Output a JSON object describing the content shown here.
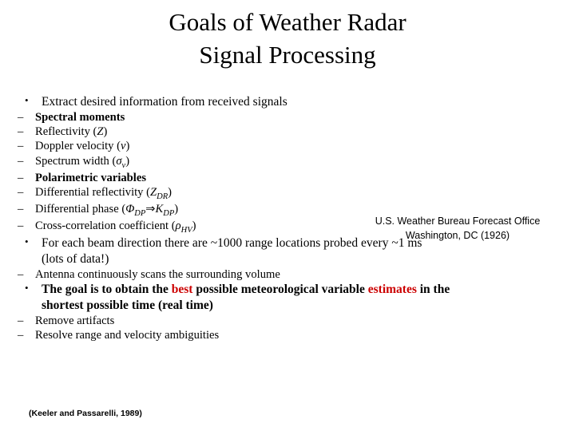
{
  "title": {
    "line1": "Goals of Weather Radar",
    "line2": "Signal Processing"
  },
  "bullets": {
    "b1": "Extract desired information from received signals",
    "spectral_moments": "Spectral moments",
    "reflectivity": "Reflectivity (",
    "reflectivity_sym": "Z",
    "reflectivity_end": ")",
    "doppler": "Doppler velocity (",
    "doppler_sym": "v",
    "doppler_end": ")",
    "spectrum_width": "Spectrum width (",
    "spectrum_width_sym": "σ",
    "spectrum_width_sub": "v",
    "spectrum_width_end": ")",
    "polarimetric": "Polarimetric variables",
    "diff_refl": "Differential reflectivity (",
    "diff_refl_sym": "Z",
    "diff_refl_sub": "DR",
    "diff_refl_end": ")",
    "diff_phase": "Differential phase (",
    "diff_phase_sym1": "Φ",
    "diff_phase_sub1": "DP",
    "diff_phase_arrow": "⇒",
    "diff_phase_sym2": "K",
    "diff_phase_sub2": "DP",
    "diff_phase_end": ")",
    "cross_corr": "Cross-correlation coefficient (",
    "cross_corr_sym": "ρ",
    "cross_corr_sub": "HV",
    "cross_corr_end": ")",
    "b2_line1": "For each beam direction there are ~1000 range locations probed every ~1 ms",
    "b2_line2": "(lots of data!)",
    "antenna": "Antenna continuously scans the surrounding volume",
    "goal_pre": "The goal is to obtain the ",
    "goal_red1": "best",
    "goal_mid": " possible meteorological variable ",
    "goal_red2": "estimates",
    "goal_post": " in the",
    "goal_line2": "shortest possible time (real time)",
    "remove_artifacts": "Remove artifacts",
    "resolve_range": "Resolve range and velocity ambiguities"
  },
  "sidenote": {
    "line1": "U.S. Weather Bureau Forecast Office",
    "line2": "Washington, DC (1926)"
  },
  "credit": "(Keeler and Passarelli, 1989)",
  "glyphs": {
    "bullet": "•",
    "dash": "–"
  },
  "colors": {
    "text": "#000000",
    "accent_red": "#cc0000",
    "background": "#ffffff"
  }
}
